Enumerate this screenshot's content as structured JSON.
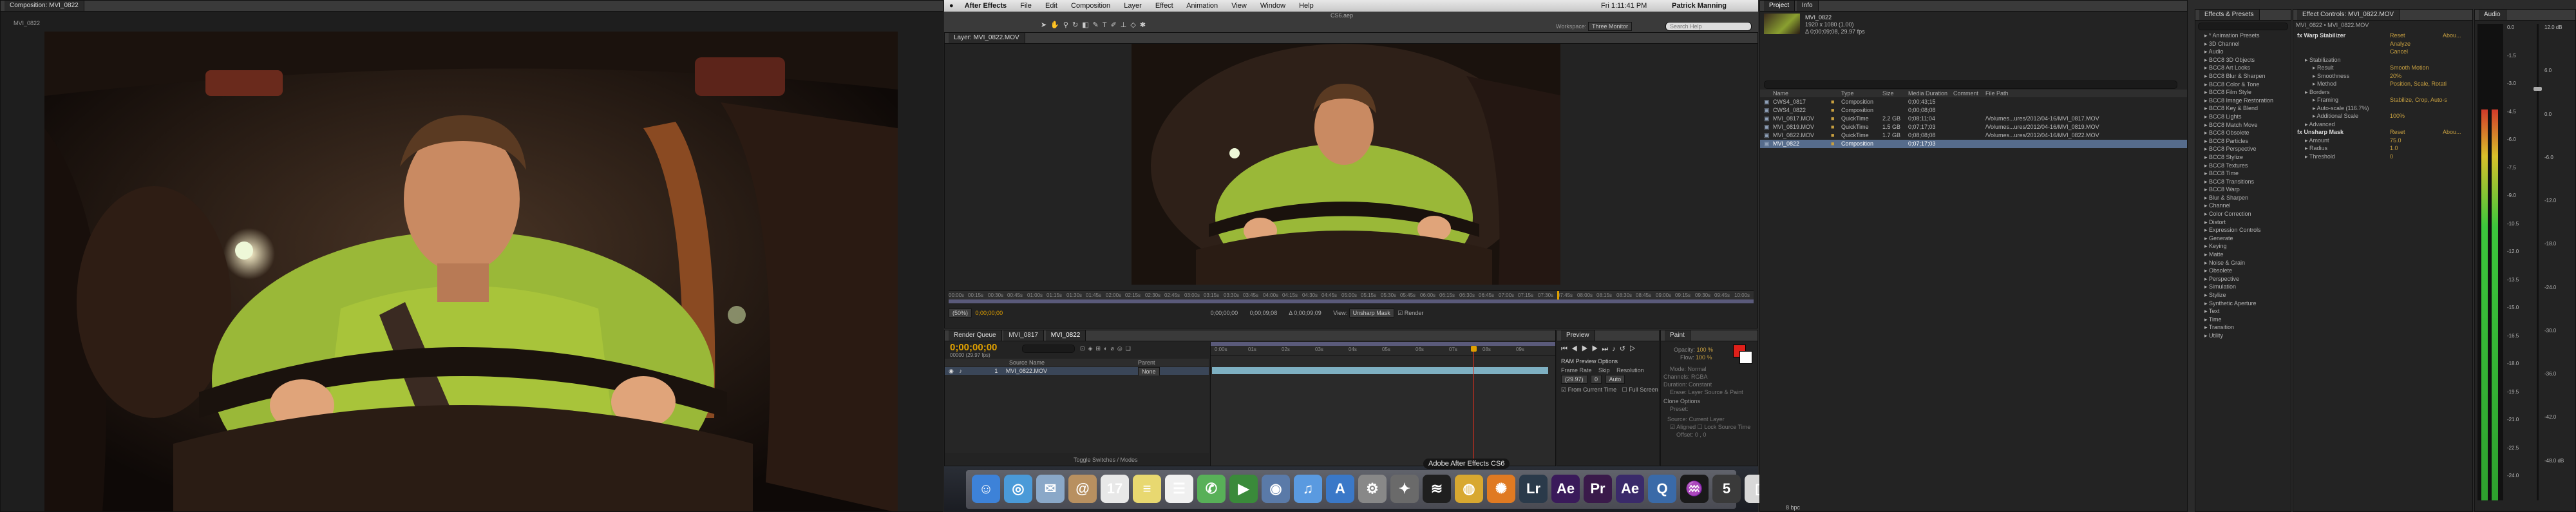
{
  "left_viewer": {
    "tab_label": "Composition: MVI_0822",
    "sub_label": "MVI_0822"
  },
  "menubar": {
    "app_name": "After Effects",
    "items": [
      "File",
      "Edit",
      "Composition",
      "Layer",
      "Effect",
      "Animation",
      "View",
      "Window",
      "Help"
    ],
    "clock": "Fri 1:11:41 PM",
    "user": "Patrick Manning",
    "doc_title": "CS6.aep",
    "workspace_label": "Workspace:",
    "workspace_value": "Three Monitor",
    "search_placeholder": "Search Help"
  },
  "layer_viewer": {
    "tab_label": "Layer: MVI_0822.MOV",
    "ruler_ticks": [
      "00:00s",
      "00:15s",
      "00:30s",
      "00:45s",
      "01:00s",
      "01:15s",
      "01:30s",
      "01:45s",
      "02:00s",
      "02:15s",
      "02:30s",
      "02:45s",
      "03:00s",
      "03:15s",
      "03:30s",
      "03:45s",
      "04:00s",
      "04:15s",
      "04:30s",
      "04:45s",
      "05:00s",
      "05:15s",
      "05:30s",
      "05:45s",
      "06:00s",
      "06:15s",
      "06:30s",
      "06:45s",
      "07:00s",
      "07:15s",
      "07:30s",
      "07:45s",
      "08:00s",
      "08:15s",
      "08:30s",
      "08:45s",
      "09:00s",
      "09:15s",
      "09:30s",
      "09:45s",
      "10:00s"
    ],
    "zoom": "(50%)",
    "timecode": "0;00;00;00",
    "in_point": "0;00;00;00",
    "out_point": "0;00;09;08",
    "duration": "Δ 0;00;09;09",
    "view_label": "View:",
    "view_value": "Unsharp Mask",
    "render_label": "Render"
  },
  "timeline": {
    "tabs": [
      "Render Queue",
      "MVI_0817",
      "MVI_0822"
    ],
    "timecode": "0;00;00;00",
    "fps_label": "00000 (29.97 fps)",
    "col_source": "Source Name",
    "col_parent": "Parent",
    "layer_num": "1",
    "layer_name": "MVI_0822.MOV",
    "parent_value": "None",
    "ruler": [
      "0:00s",
      "01s",
      "02s",
      "03s",
      "04s",
      "05s",
      "06s",
      "07s",
      "08s",
      "09s"
    ],
    "footer_label": "Toggle Switches / Modes"
  },
  "preview": {
    "tab_label": "Preview",
    "ram_options": "RAM Preview Options",
    "frame_rate_label": "Frame Rate",
    "skip_label": "Skip",
    "resolution_label": "Resolution",
    "frame_rate": "(29.97)",
    "skip": "0",
    "resolution": "Auto",
    "from_current": "From Current Time",
    "full_screen": "Full Screen"
  },
  "paint": {
    "tab_label": "Paint",
    "opacity_label": "Opacity:",
    "opacity": "100 %",
    "flow_label": "Flow:",
    "flow": "100 %",
    "mode_label": "Mode:",
    "mode": "Normal",
    "channels_label": "Channels:",
    "channels": "RGBA",
    "duration_label": "Duration:",
    "duration": "Constant",
    "erase_label": "Erase:",
    "erase": "Layer Source & Paint",
    "clone_options": "Clone Options",
    "preset_label": "Preset:",
    "source_label": "Source:",
    "source": "Current Layer",
    "aligned": "Aligned",
    "lock_source": "Lock Source Time",
    "offset_label": "Offset:",
    "offset": "0 , 0"
  },
  "tooltip": "Adobe After Effects CS6",
  "dock": {
    "icons": [
      {
        "name": "finder-icon",
        "glyph": "☺",
        "color": "#3d82d8"
      },
      {
        "name": "safari-icon",
        "glyph": "◎",
        "color": "#4a9ad8"
      },
      {
        "name": "mail-icon",
        "glyph": "✉",
        "color": "#8aa8c8"
      },
      {
        "name": "contacts-icon",
        "glyph": "@",
        "color": "#b89060"
      },
      {
        "name": "calendar-icon",
        "glyph": "17",
        "color": "#e8e8e8"
      },
      {
        "name": "notes-icon",
        "glyph": "≡",
        "color": "#e8d870"
      },
      {
        "name": "reminders-icon",
        "glyph": "☰",
        "color": "#f0f0f0"
      },
      {
        "name": "messages-icon",
        "glyph": "✆",
        "color": "#58b058"
      },
      {
        "name": "facetime-icon",
        "glyph": "▶",
        "color": "#3a8a3a"
      },
      {
        "name": "photos-icon",
        "glyph": "◉",
        "color": "#5a7aa8"
      },
      {
        "name": "itunes-icon",
        "glyph": "♫",
        "color": "#5a9ae0"
      },
      {
        "name": "appstore-icon",
        "glyph": "A",
        "color": "#3a78c8"
      },
      {
        "name": "preferences-icon",
        "glyph": "⚙",
        "color": "#888888"
      },
      {
        "name": "utility-icon",
        "glyph": "✦",
        "color": "#6a6a6a"
      },
      {
        "name": "spotify-icon",
        "glyph": "≋",
        "color": "#1f1f1f"
      },
      {
        "name": "chrome-icon",
        "glyph": "◍",
        "color": "#d8a830"
      },
      {
        "name": "firefox-icon",
        "glyph": "✺",
        "color": "#e07a22"
      },
      {
        "name": "lightroom-icon",
        "glyph": "Lr",
        "color": "#2a3a4a"
      },
      {
        "name": "aftereffects-icon",
        "glyph": "Ae",
        "color": "#3a1a5a"
      },
      {
        "name": "premiere-icon",
        "glyph": "Pr",
        "color": "#3a1a4a"
      },
      {
        "name": "aftereffects-cs6-icon",
        "glyph": "Ae",
        "color": "#3a2a6a"
      },
      {
        "name": "quicktime-icon",
        "glyph": "Q",
        "color": "#3a6aa8"
      },
      {
        "name": "activity-icon",
        "glyph": "♒",
        "color": "#1a1a1a"
      },
      {
        "name": "five-icon",
        "glyph": "5",
        "color": "#3a3a3a"
      },
      {
        "name": "document-icon",
        "glyph": "▯",
        "color": "#d8d8d8"
      },
      {
        "name": "trash-icon",
        "glyph": "🗑",
        "color": "#8a8a8a"
      }
    ]
  },
  "project": {
    "tabs": [
      "Project",
      "Info"
    ],
    "selected_name": "MVI_0822",
    "selected_meta": [
      "1920 x 1080 (1.00)",
      "Δ 0;00;09;08, 29.97 fps"
    ],
    "cols": [
      "Name",
      "Type",
      "Size",
      "Media Duration",
      "Comment",
      "File Path"
    ],
    "rows": [
      {
        "name": "CWS4_0817",
        "type": "Composition",
        "size": "",
        "duration": "0;00;43;15",
        "path": ""
      },
      {
        "name": "CWS4_0822",
        "type": "Composition",
        "size": "",
        "duration": "0;00;08;08",
        "path": ""
      },
      {
        "name": "MVI_0817.MOV",
        "type": "QuickTime",
        "size": "2.2 GB",
        "duration": "0;08;11;04",
        "path": "/Volumes...ures/2012/04-16/MVI_0817.MOV"
      },
      {
        "name": "MVI_0819.MOV",
        "type": "QuickTime",
        "size": "1.5 GB",
        "duration": "0;07;17;03",
        "path": "/Volumes...ures/2012/04-16/MVI_0819.MOV"
      },
      {
        "name": "MVI_0822.MOV",
        "type": "QuickTime",
        "size": "1.7 GB",
        "duration": "0;08;08;08",
        "path": "/Volumes...ures/2012/04-16/MVI_0822.MOV"
      },
      {
        "name": "MVI_0822",
        "type": "Composition",
        "size": "",
        "duration": "0;07;17;03",
        "path": ""
      }
    ],
    "footer": "8 bpc"
  },
  "effects_presets": {
    "tab_label": "Effects & Presets",
    "items": [
      "* Animation Presets",
      "3D Channel",
      "Audio",
      "BCC8 3D Objects",
      "BCC8 Art Looks",
      "BCC8 Blur & Sharpen",
      "BCC8 Color & Tone",
      "BCC8 Film Style",
      "BCC8 Image Restoration",
      "BCC8 Key & Blend",
      "BCC8 Lights",
      "BCC8 Match Move",
      "BCC8 Obsolete",
      "BCC8 Particles",
      "BCC8 Perspective",
      "BCC8 Stylize",
      "BCC8 Textures",
      "BCC8 Time",
      "BCC8 Transitions",
      "BCC8 Warp",
      "Blur & Sharpen",
      "Channel",
      "Color Correction",
      "Distort",
      "Expression Controls",
      "Generate",
      "Keying",
      "Matte",
      "Noise & Grain",
      "Obsolete",
      "Perspective",
      "Simulation",
      "Stylize",
      "Synthetic Aperture",
      "Text",
      "Time",
      "Transition",
      "Utility"
    ]
  },
  "effect_controls": {
    "tab_label": "Effect Controls: MVI_0822.MOV",
    "breadcrumb": "MVI_0822 • MVI_0822.MOV",
    "rows": [
      {
        "label": "Warp Stabilizer",
        "value": "Reset",
        "extra": "Abou...",
        "indent": 0
      },
      {
        "label": "",
        "value": "Analyze",
        "extra": "",
        "indent": 1
      },
      {
        "label": "",
        "value": "Cancel",
        "extra": "",
        "indent": 1
      },
      {
        "label": "Stabilization",
        "value": "",
        "extra": "",
        "indent": 1
      },
      {
        "label": "Result",
        "value": "Smooth Motion",
        "extra": "",
        "indent": 2
      },
      {
        "label": "Smoothness",
        "value": "20%",
        "extra": "",
        "indent": 2
      },
      {
        "label": "Method",
        "value": "Position, Scale, Rotati",
        "extra": "",
        "indent": 2
      },
      {
        "label": "Borders",
        "value": "",
        "extra": "",
        "indent": 1
      },
      {
        "label": "Framing",
        "value": "Stabilize, Crop, Auto-s",
        "extra": "",
        "indent": 2
      },
      {
        "label": "Auto-scale (116.7%)",
        "value": "",
        "extra": "",
        "indent": 2
      },
      {
        "label": "Additional Scale",
        "value": "100%",
        "extra": "",
        "indent": 2
      },
      {
        "label": "Advanced",
        "value": "",
        "extra": "",
        "indent": 1
      },
      {
        "label": "Unsharp Mask",
        "value": "Reset",
        "extra": "Abou...",
        "indent": 0
      },
      {
        "label": "Amount",
        "value": "75.0",
        "extra": "",
        "indent": 1
      },
      {
        "label": "Radius",
        "value": "1.0",
        "extra": "",
        "indent": 1
      },
      {
        "label": "Threshold",
        "value": "0",
        "extra": "",
        "indent": 1
      }
    ]
  },
  "audio": {
    "tab_label": "Audio",
    "left_scale": [
      "0.0",
      "-1.5",
      "-3.0",
      "-4.5",
      "-6.0",
      "-7.5",
      "-9.0",
      "-10.5",
      "-12.0",
      "-13.5",
      "-15.0",
      "-16.5",
      "-18.0",
      "-19.5",
      "-21.0",
      "-22.5",
      "-24.0"
    ],
    "right_scale": [
      "12.0 dB",
      "6.0",
      "0.0",
      "-6.0",
      "-12.0",
      "-18.0",
      "-24.0",
      "-30.0",
      "-36.0",
      "-42.0",
      "-48.0 dB"
    ],
    "left_level": 0.82,
    "right_level": 0.82
  },
  "colors": {
    "accent": "#e0a000",
    "timecode": "#e0a000",
    "selection": "#566c8c",
    "clip_bar": "#7eb0c2",
    "playhead": "#e0301e"
  }
}
